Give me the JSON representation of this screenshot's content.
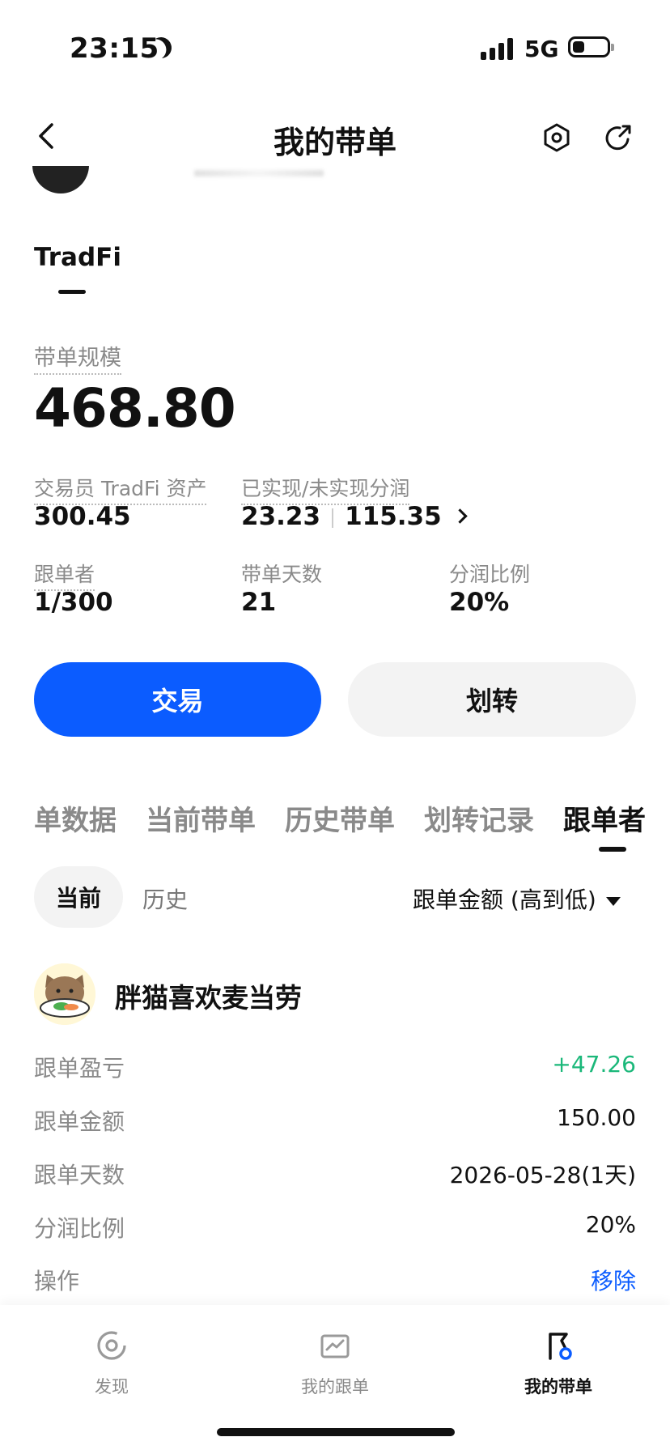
{
  "status": {
    "time": "23:15",
    "network": "5G"
  },
  "header": {
    "title": "我的带单"
  },
  "account_tab": {
    "label": "TradFi"
  },
  "scale": {
    "label": "带单规模",
    "value": "468.80"
  },
  "stats": {
    "assets_label": "交易员 TradFi 资产",
    "assets_value": "300.45",
    "profit_label": "已实现/未实现分润",
    "realized": "23.23",
    "unrealized": "115.35",
    "followers_label": "跟单者",
    "followers_value": "1/300",
    "days_label": "带单天数",
    "days_value": "21",
    "share_label": "分润比例",
    "share_value": "20%"
  },
  "buttons": {
    "trade": "交易",
    "transfer": "划转"
  },
  "section_tabs": [
    "单数据",
    "当前带单",
    "历史带单",
    "划转记录",
    "跟单者"
  ],
  "sub_tabs": {
    "current": "当前",
    "history": "历史",
    "sort": "跟单金额 (高到低)"
  },
  "follower": {
    "name": "胖猫喜欢麦当劳",
    "rows": [
      {
        "label": "跟单盈亏",
        "value": "+47.26"
      },
      {
        "label": "跟单金额",
        "value": "150.00"
      },
      {
        "label": "跟单天数",
        "value": "2026-05-28(1天)"
      },
      {
        "label": "分润比例",
        "value": "20%"
      },
      {
        "label": "操作",
        "value": "移除"
      }
    ]
  },
  "colors": {
    "accent": "#0b5cff",
    "profit": "#1bb87a"
  },
  "nav": [
    {
      "label": "发现",
      "icon": "discover-icon"
    },
    {
      "label": "我的跟单",
      "icon": "chart-card-icon"
    },
    {
      "label": "我的带单",
      "icon": "flag-icon"
    }
  ]
}
